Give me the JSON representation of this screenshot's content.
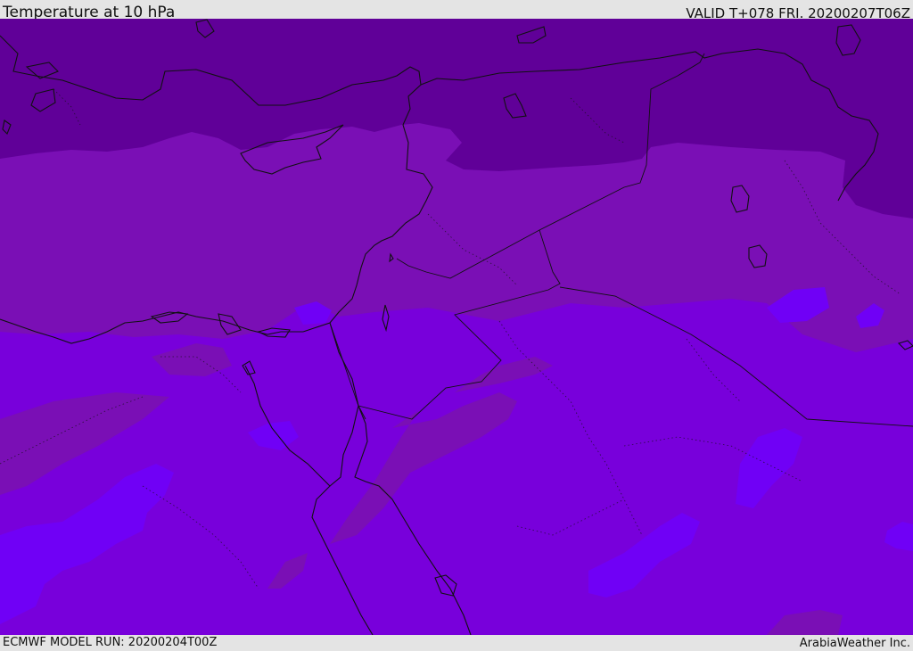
{
  "header": {
    "title": "Temperature at 10 hPa",
    "valid_time": "VALID T+078 FRI. 20200207T06Z"
  },
  "footer": {
    "model_run": "ECMWF MODEL RUN: 20200204T00Z",
    "credit": "ArabiaWeather Inc."
  },
  "map": {
    "region": "Eastern Mediterranean & Middle East",
    "colors": {
      "band_darkest": "#600098",
      "band_dark": "#7a0fb5",
      "band_mid": "#7800db",
      "band_light": "#7000f6",
      "coastline": "#111111"
    }
  }
}
